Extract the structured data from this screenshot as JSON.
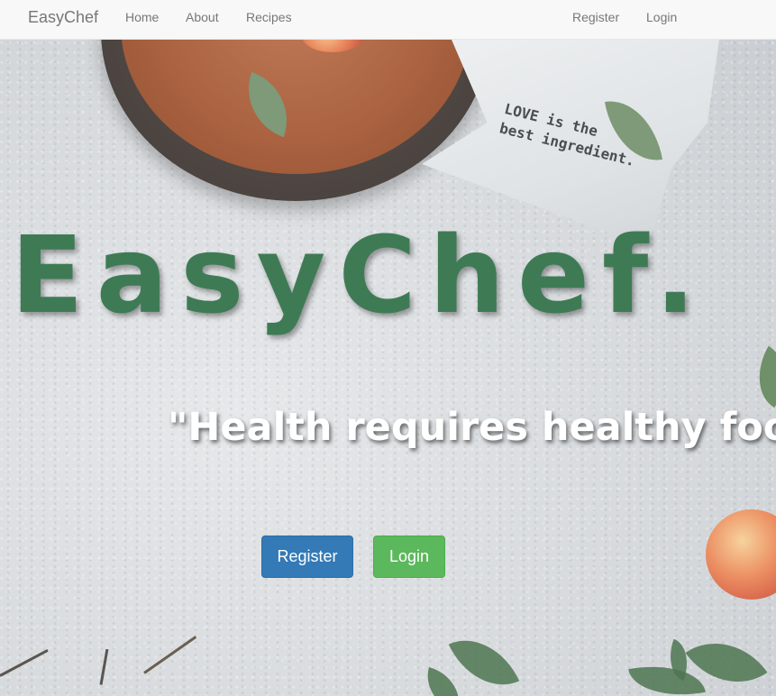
{
  "navbar": {
    "brand": "EasyChef",
    "links": [
      "Home",
      "About",
      "Recipes"
    ],
    "right_links": [
      "Register",
      "Login"
    ]
  },
  "decor": {
    "cloth_text": [
      "LOVE is the",
      "best ingredient."
    ]
  },
  "hero": {
    "title": "EasyChef.",
    "quote": "\"Health requires healthy food\""
  },
  "buttons": {
    "register_label": "Register",
    "login_label": "Login"
  },
  "colors": {
    "title_green": "#3e7b55",
    "primary_blue": "#337ab7",
    "success_green": "#5cb85c"
  }
}
